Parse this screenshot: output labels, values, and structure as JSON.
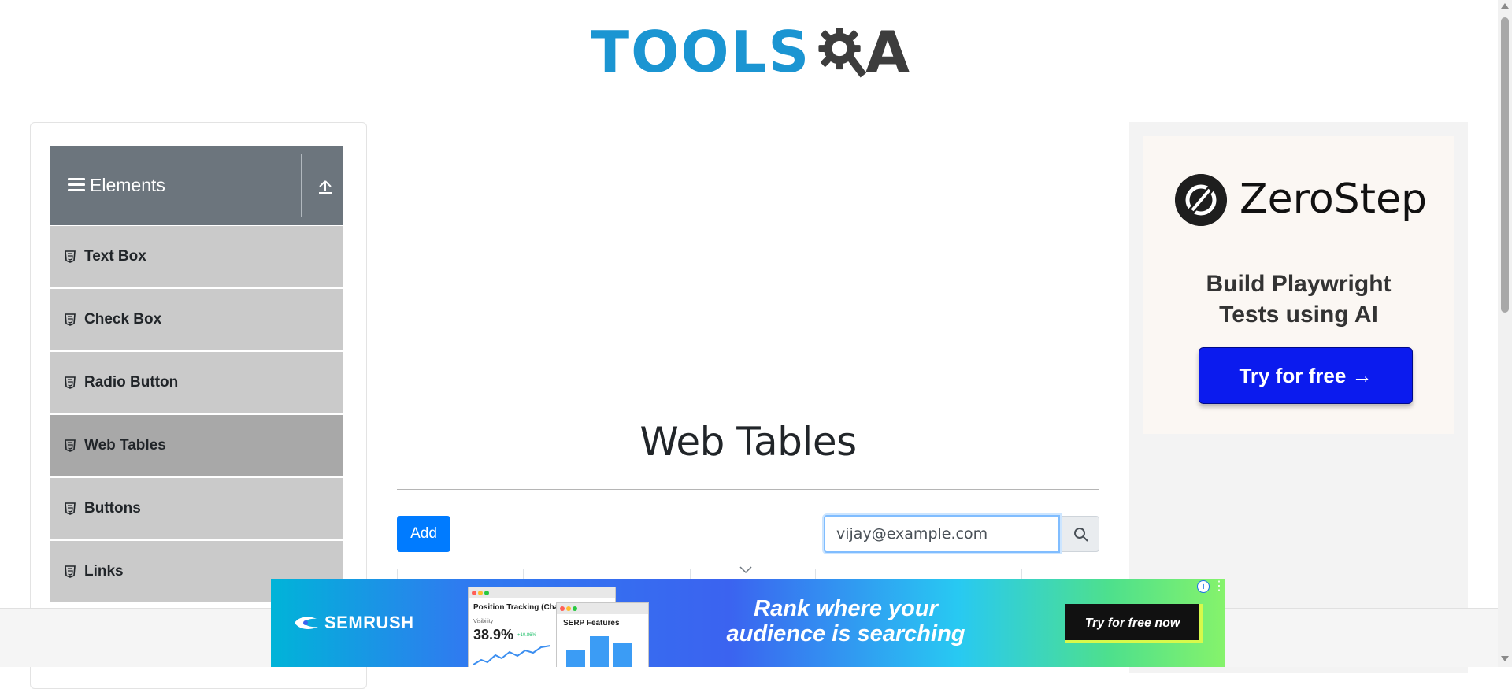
{
  "header": {
    "logo_text_tools": "TOOLS",
    "logo_text_a": "A",
    "logo_icon": "gear-magnifier-icon"
  },
  "sidebar": {
    "group_title": "Elements",
    "group_icons": [
      "hamburger-icon",
      "upload-icon"
    ],
    "items": [
      {
        "label": "Text Box",
        "active": false
      },
      {
        "label": "Check Box",
        "active": false
      },
      {
        "label": "Radio Button",
        "active": false
      },
      {
        "label": "Web Tables",
        "active": true
      },
      {
        "label": "Buttons",
        "active": false
      },
      {
        "label": "Links",
        "active": false
      }
    ]
  },
  "main": {
    "title": "Web Tables",
    "add_label": "Add",
    "search_value": "vijay@example.com",
    "search_icon": "search-icon"
  },
  "right_ad": {
    "brand": "ZeroStep",
    "subtitle_line1": "Build Playwright",
    "subtitle_line2": "Tests using AI",
    "cta": "Try for free →"
  },
  "bottom_ad": {
    "brand": "SEMRUSH",
    "shot1_title": "Position Tracking (ChatG",
    "shot1_small": "Visibility",
    "shot1_value": "38.9%",
    "shot1_delta": "+10.86%",
    "shot2_title": "SERP Features",
    "headline_line1": "Rank where your",
    "headline_line2": "audience is searching",
    "cta": "Try for free now",
    "info_glyph": "i",
    "more_glyph": "⋮"
  },
  "colors": {
    "brand_blue": "#1b95d2",
    "sidebar_header": "#6c757d",
    "menu_item": "#cacaca",
    "menu_active": "#a8a8a8",
    "primary_button": "#007bff",
    "zerostep_button": "#0b1bee"
  }
}
